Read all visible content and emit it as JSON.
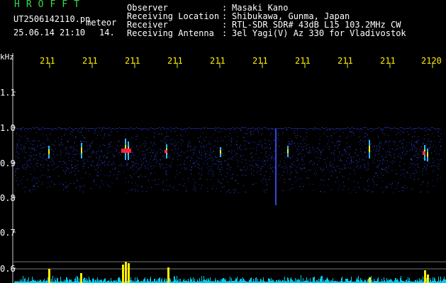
{
  "header": {
    "brand": "HROFFT",
    "filename": "UT2506142110.pn",
    "tag": "meteor",
    "datetime": "25.06.14 21:10",
    "count": "14."
  },
  "meta": [
    {
      "label": "Observer",
      "value": "Masaki Kano"
    },
    {
      "label": "Receiving Location",
      "value": "Shibukawa, Gunma, Japan"
    },
    {
      "label": "Receiver",
      "value": "RTL-SDR SDR# 43dB L15 103.2MHz CW"
    },
    {
      "label": "Receiving Antenna",
      "value": "3el Yagi(V) Az 330 for Vladivostok"
    }
  ],
  "colon": ":",
  "axis": {
    "unit": "kHz",
    "time_ticks": [
      "211",
      "211",
      "211",
      "211",
      "211",
      "211",
      "211",
      "211",
      "211",
      "2120"
    ],
    "freq_ticks": [
      "1.1",
      "1.0",
      "0.9",
      "0.8",
      "0.7",
      "0.6"
    ]
  },
  "colors": {
    "brand": "#33dd44",
    "tick": "#ffee00",
    "noise": "#2233cc",
    "baseline": "#00ccee",
    "peak": "#ffee00"
  }
}
